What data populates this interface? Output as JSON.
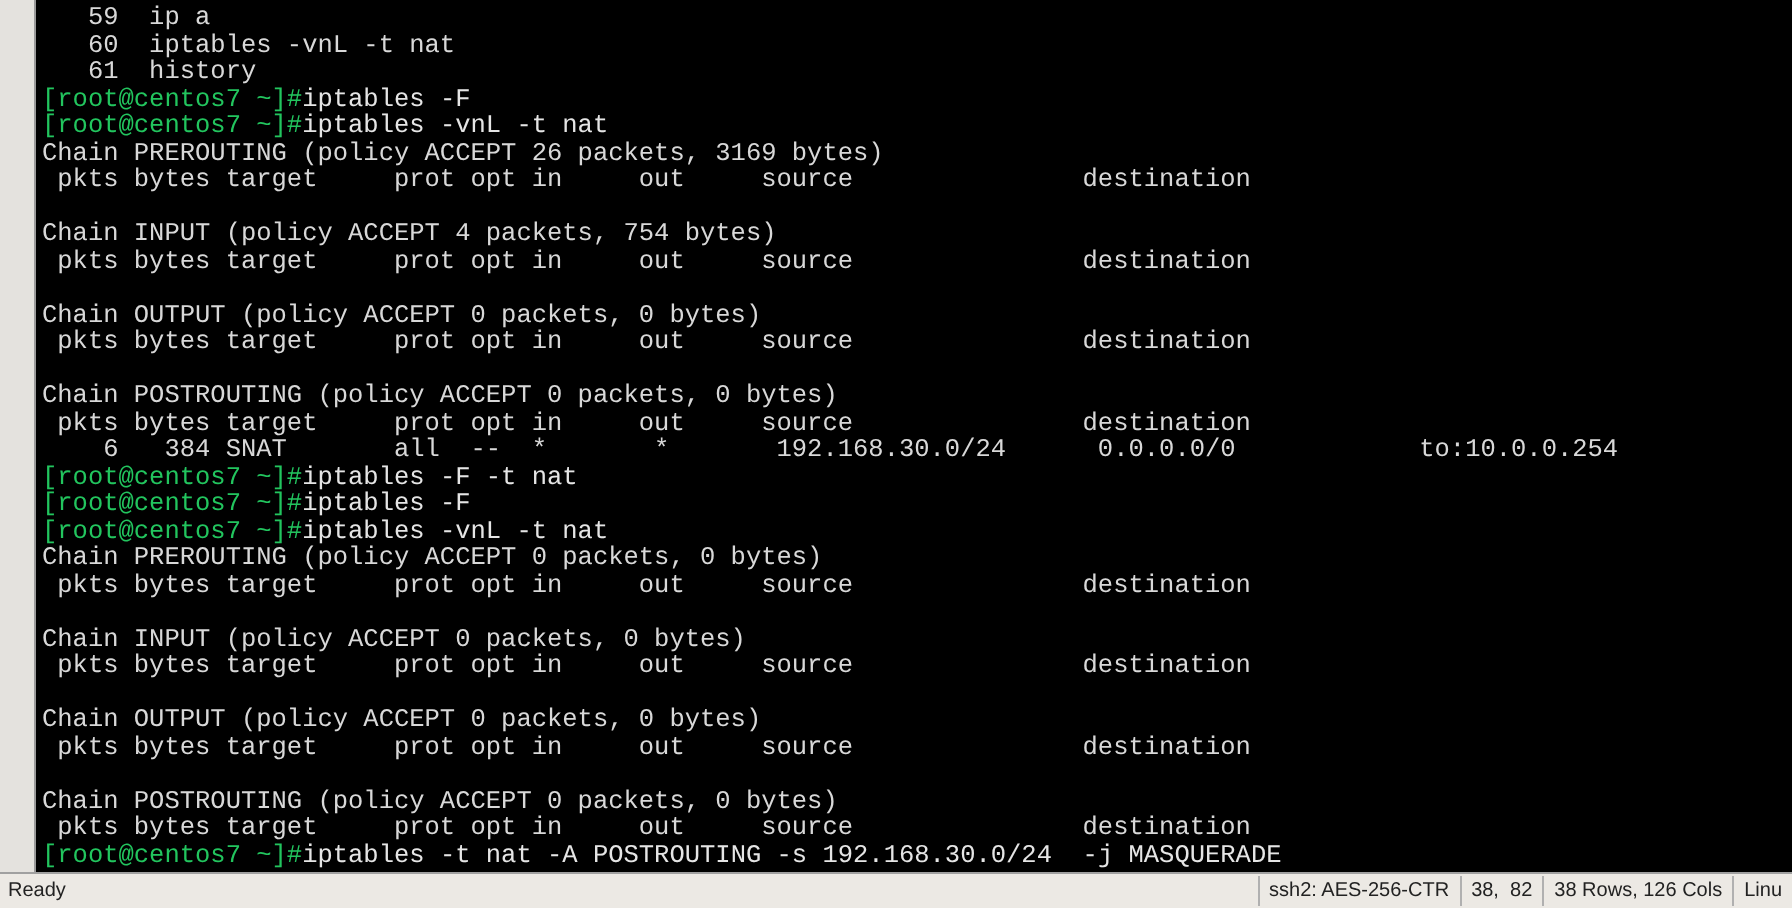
{
  "terminal": {
    "lines": [
      {
        "kind": "output",
        "text": "   59  ip a"
      },
      {
        "kind": "output",
        "text": "   60  iptables -vnL -t nat"
      },
      {
        "kind": "output",
        "text": "   61  history"
      },
      {
        "kind": "prompt",
        "prompt": "[root@centos7 ~]#",
        "command": "iptables -F"
      },
      {
        "kind": "prompt",
        "prompt": "[root@centos7 ~]#",
        "command": "iptables -vnL -t nat"
      },
      {
        "kind": "output",
        "text": "Chain PREROUTING (policy ACCEPT 26 packets, 3169 bytes)"
      },
      {
        "kind": "output",
        "text": " pkts bytes target     prot opt in     out     source               destination"
      },
      {
        "kind": "blank"
      },
      {
        "kind": "output",
        "text": "Chain INPUT (policy ACCEPT 4 packets, 754 bytes)"
      },
      {
        "kind": "output",
        "text": " pkts bytes target     prot opt in     out     source               destination"
      },
      {
        "kind": "blank"
      },
      {
        "kind": "output",
        "text": "Chain OUTPUT (policy ACCEPT 0 packets, 0 bytes)"
      },
      {
        "kind": "output",
        "text": " pkts bytes target     prot opt in     out     source               destination"
      },
      {
        "kind": "blank"
      },
      {
        "kind": "output",
        "text": "Chain POSTROUTING (policy ACCEPT 0 packets, 0 bytes)"
      },
      {
        "kind": "output",
        "text": " pkts bytes target     prot opt in     out     source               destination"
      },
      {
        "kind": "output",
        "text": "    6   384 SNAT       all  --  *       *       192.168.30.0/24      0.0.0.0/0            to:10.0.0.254"
      },
      {
        "kind": "prompt",
        "prompt": "[root@centos7 ~]#",
        "command": "iptables -F -t nat"
      },
      {
        "kind": "prompt",
        "prompt": "[root@centos7 ~]#",
        "command": "iptables -F"
      },
      {
        "kind": "prompt",
        "prompt": "[root@centos7 ~]#",
        "command": "iptables -vnL -t nat"
      },
      {
        "kind": "output",
        "text": "Chain PREROUTING (policy ACCEPT 0 packets, 0 bytes)"
      },
      {
        "kind": "output",
        "text": " pkts bytes target     prot opt in     out     source               destination"
      },
      {
        "kind": "blank"
      },
      {
        "kind": "output",
        "text": "Chain INPUT (policy ACCEPT 0 packets, 0 bytes)"
      },
      {
        "kind": "output",
        "text": " pkts bytes target     prot opt in     out     source               destination"
      },
      {
        "kind": "blank"
      },
      {
        "kind": "output",
        "text": "Chain OUTPUT (policy ACCEPT 0 packets, 0 bytes)"
      },
      {
        "kind": "output",
        "text": " pkts bytes target     prot opt in     out     source               destination"
      },
      {
        "kind": "blank"
      },
      {
        "kind": "output",
        "text": "Chain POSTROUTING (policy ACCEPT 0 packets, 0 bytes)"
      },
      {
        "kind": "output",
        "text": " pkts bytes target     prot opt in     out     source               destination"
      },
      {
        "kind": "prompt",
        "prompt": "[root@centos7 ~]#",
        "command": "iptables -t nat -A POSTROUTING -s 192.168.30.0/24  -j MASQUERADE"
      }
    ]
  },
  "status_bar": {
    "status": "Ready",
    "sections": [
      "ssh2: AES-256-CTR",
      "38,  82",
      "38 Rows, 126 Cols",
      "Linu"
    ]
  }
}
